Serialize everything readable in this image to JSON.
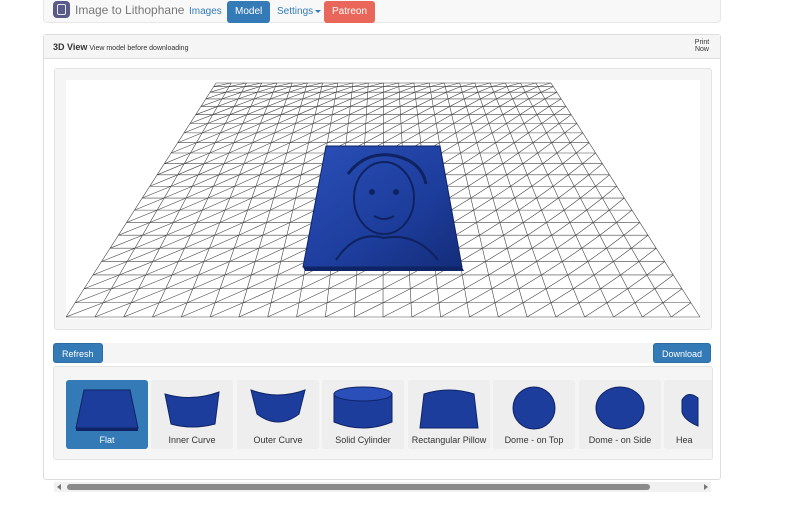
{
  "navbar": {
    "brand": "Image to Lithophane",
    "links": [
      "Images",
      "Model",
      "Settings",
      "Patreon"
    ],
    "active": "Model"
  },
  "panel": {
    "title": "3D View",
    "subtitle": "View model before downloading",
    "print_now": "Print Now"
  },
  "toolbar": {
    "refresh": "Refresh",
    "download": "Download"
  },
  "shapes": [
    {
      "label": "Flat",
      "icon": "flat-plate-icon",
      "selected": true
    },
    {
      "label": "Inner Curve",
      "icon": "inner-curve-icon"
    },
    {
      "label": "Outer Curve",
      "icon": "outer-curve-icon"
    },
    {
      "label": "Solid Cylinder",
      "icon": "solid-cylinder-icon"
    },
    {
      "label": "Rectangular Pillow",
      "icon": "rectangular-pillow-icon"
    },
    {
      "label": "Dome - on Top",
      "icon": "dome-top-icon"
    },
    {
      "label": "Dome - on Side",
      "icon": "dome-side-icon"
    },
    {
      "label": "Hea",
      "icon": "heart-icon"
    }
  ],
  "colors": {
    "primary": "#337ab7",
    "patreon": "#e8675a",
    "model": "#1f3f9a"
  }
}
